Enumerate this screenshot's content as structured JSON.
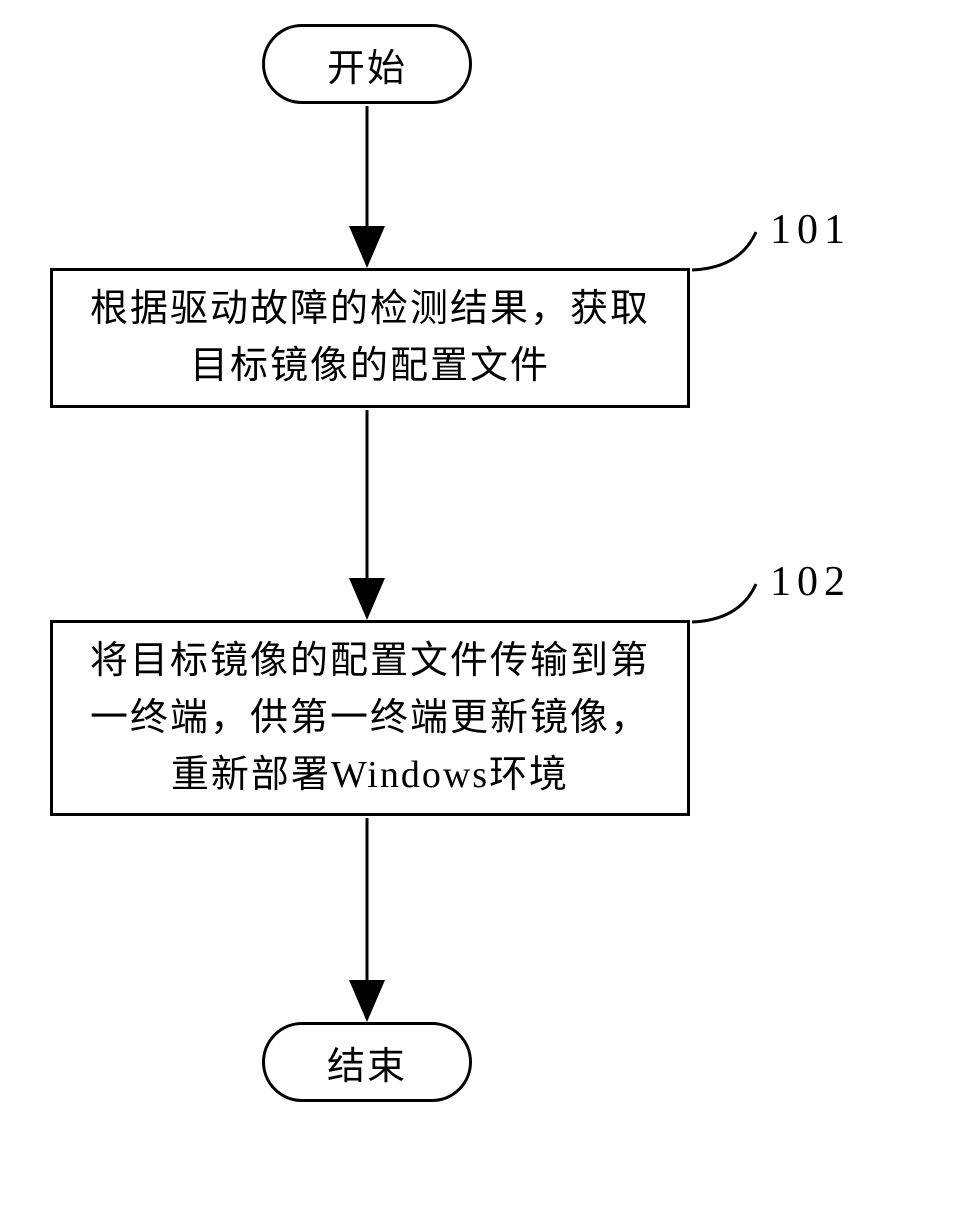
{
  "flowchart": {
    "start": "开始",
    "end": "结束",
    "steps": [
      {
        "id": "101",
        "text": "根据驱动故障的检测结果，获取\n目标镜像的配置文件"
      },
      {
        "id": "102",
        "text": "将目标镜像的配置文件传输到第\n一终端，供第一终端更新镜像，\n重新部署Windows环境"
      }
    ]
  }
}
